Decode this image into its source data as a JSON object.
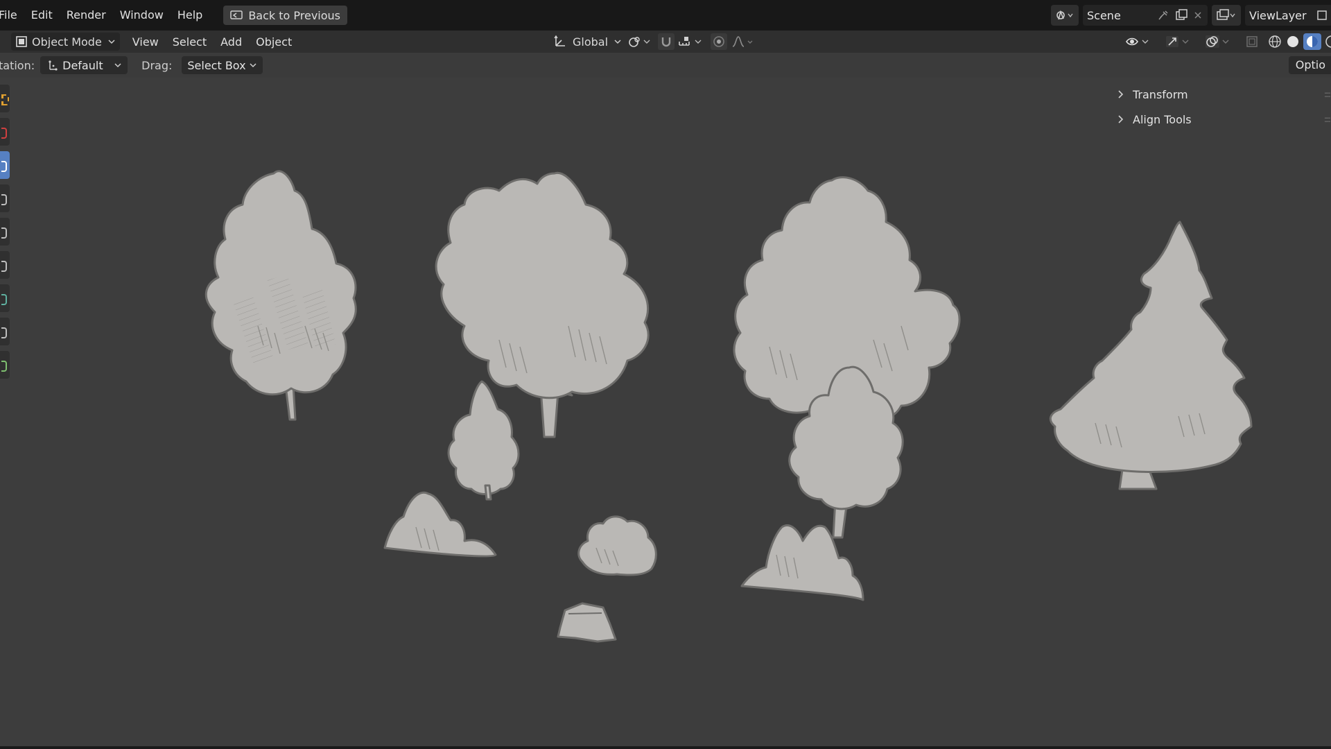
{
  "topbar": {
    "menus": [
      "File",
      "Edit",
      "Render",
      "Window",
      "Help"
    ],
    "back_label": "Back to Previous",
    "scene_label": "Scene",
    "viewlayer_label": "ViewLayer"
  },
  "header": {
    "mode_label": "Object Mode",
    "menus": [
      "View",
      "Select",
      "Add",
      "Object"
    ],
    "orientation_label": "Global"
  },
  "toolsettings": {
    "orientation_prefix": "tation:",
    "orientation_value": "Default",
    "drag_label": "Drag:",
    "drag_value": "Select Box",
    "options_label": "Optio"
  },
  "npanel": {
    "items": [
      "Transform",
      "Align Tools"
    ]
  },
  "colors": {
    "accent": "#5680c2",
    "foliage": "#bab8b5",
    "outline": "#6e6d6b",
    "viewport": "#3d3d3d"
  }
}
